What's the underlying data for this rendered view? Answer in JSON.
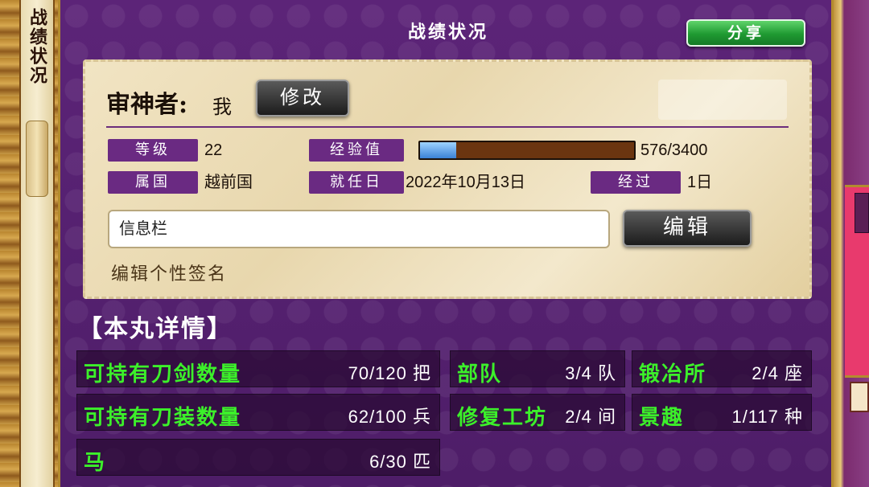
{
  "side": {
    "title": "战绩状况"
  },
  "header": {
    "title": "战绩状况",
    "share_label": "分享"
  },
  "profile": {
    "owner_label": "审神者:",
    "owner_name": "我",
    "modify_label": "修改",
    "level_label": "等级",
    "level_value": "22",
    "exp_label": "经验值",
    "exp_current": 576,
    "exp_max": 3400,
    "exp_text": "576/3400",
    "country_label": "属国",
    "country_value": "越前国",
    "appointed_label": "就任日",
    "appointed_value": "2022年10月13日",
    "elapsed_label": "经过",
    "elapsed_value": "1日",
    "message_value": "信息栏",
    "edit_label": "编辑",
    "signature_hint": "编辑个性签名"
  },
  "details": {
    "title": "【本丸详情】",
    "stats": [
      {
        "label": "可持有刀剑数量",
        "value": "70/120 把"
      },
      {
        "label": "部队",
        "value": "3/4 队"
      },
      {
        "label": "锻冶所",
        "value": "2/4 座"
      },
      {
        "label": "可持有刀装数量",
        "value": "62/100 兵"
      },
      {
        "label": "修复工坊",
        "value": "2/4 间"
      },
      {
        "label": "景趣",
        "value": "1/117 种"
      },
      {
        "label": "马",
        "value": "6/30 匹"
      }
    ]
  },
  "colors": {
    "panel": "#5c2478",
    "stat_label": "#3cf02a",
    "share_button": "#1f9a32",
    "exp_fill": "#3b82d6"
  }
}
